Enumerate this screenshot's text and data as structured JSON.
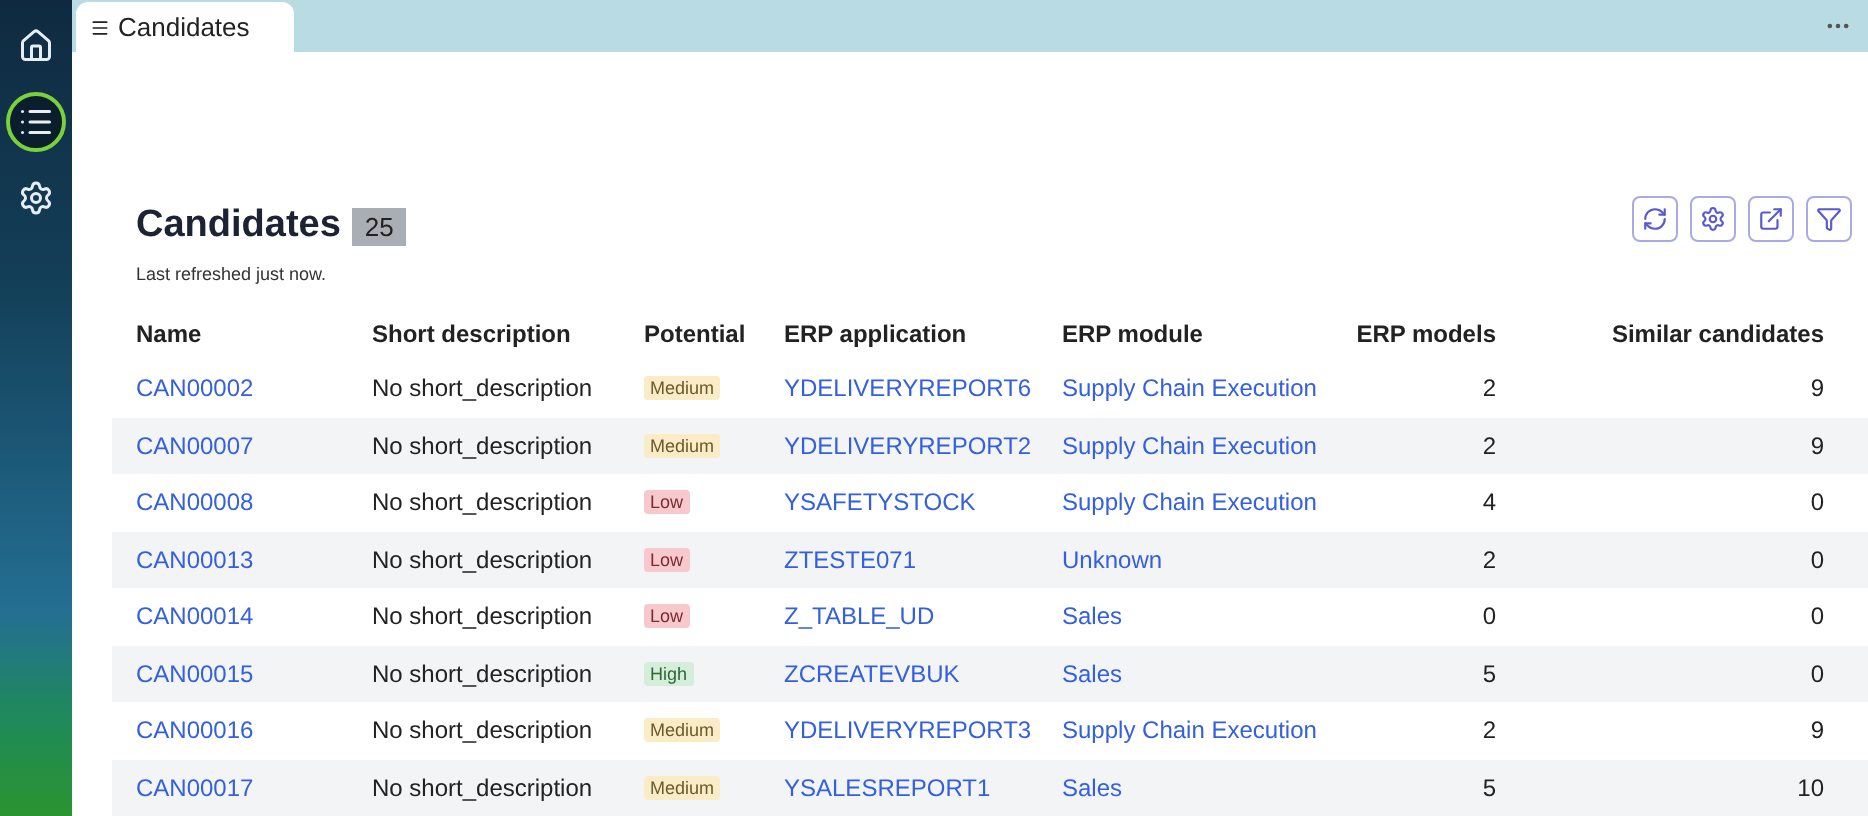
{
  "sidebar": {
    "items": [
      {
        "kind": "home",
        "selected": false
      },
      {
        "kind": "list",
        "selected": true
      },
      {
        "kind": "settings",
        "selected": false
      }
    ]
  },
  "tabs": [
    {
      "label": "Candidates",
      "selected": true
    }
  ],
  "page": {
    "title": "Candidates",
    "count": "25",
    "subtitle": "Last refreshed just now."
  },
  "toolbar": [
    {
      "kind": "refresh"
    },
    {
      "kind": "settings"
    },
    {
      "kind": "export"
    },
    {
      "kind": "filter"
    }
  ],
  "table": {
    "columns": [
      "Name",
      "Short description",
      "Potential",
      "ERP application",
      "ERP module",
      "ERP models",
      "Similar candidates"
    ],
    "rows": [
      {
        "name": "CAN00002",
        "description": "No short_description",
        "potential": {
          "label": "Medium",
          "kind": "medium"
        },
        "application": "YDELIVERYREPORT6",
        "module": "Supply Chain Execution",
        "models": "2",
        "similar": "9"
      },
      {
        "name": "CAN00007",
        "description": "No short_description",
        "potential": {
          "label": "Medium",
          "kind": "medium"
        },
        "application": "YDELIVERYREPORT2",
        "module": "Supply Chain Execution",
        "models": "2",
        "similar": "9"
      },
      {
        "name": "CAN00008",
        "description": "No short_description",
        "potential": {
          "label": "Low",
          "kind": "low"
        },
        "application": "YSAFETYSTOCK",
        "module": "Supply Chain Execution",
        "models": "4",
        "similar": "0"
      },
      {
        "name": "CAN00013",
        "description": "No short_description",
        "potential": {
          "label": "Low",
          "kind": "low"
        },
        "application": "ZTESTE071",
        "module": "Unknown",
        "models": "2",
        "similar": "0"
      },
      {
        "name": "CAN00014",
        "description": "No short_description",
        "potential": {
          "label": "Low",
          "kind": "low"
        },
        "application": "Z_TABLE_UD",
        "module": "Sales",
        "models": "0",
        "similar": "0"
      },
      {
        "name": "CAN00015",
        "description": "No short_description",
        "potential": {
          "label": "High",
          "kind": "high"
        },
        "application": "ZCREATEVBUK",
        "module": "Sales",
        "models": "5",
        "similar": "0"
      },
      {
        "name": "CAN00016",
        "description": "No short_description",
        "potential": {
          "label": "Medium",
          "kind": "medium"
        },
        "application": "YDELIVERYREPORT3",
        "module": "Supply Chain Execution",
        "models": "2",
        "similar": "9"
      },
      {
        "name": "CAN00017",
        "description": "No short_description",
        "potential": {
          "label": "Medium",
          "kind": "medium"
        },
        "application": "YSALESREPORT1",
        "module": "Sales",
        "models": "5",
        "similar": "10"
      }
    ]
  }
}
